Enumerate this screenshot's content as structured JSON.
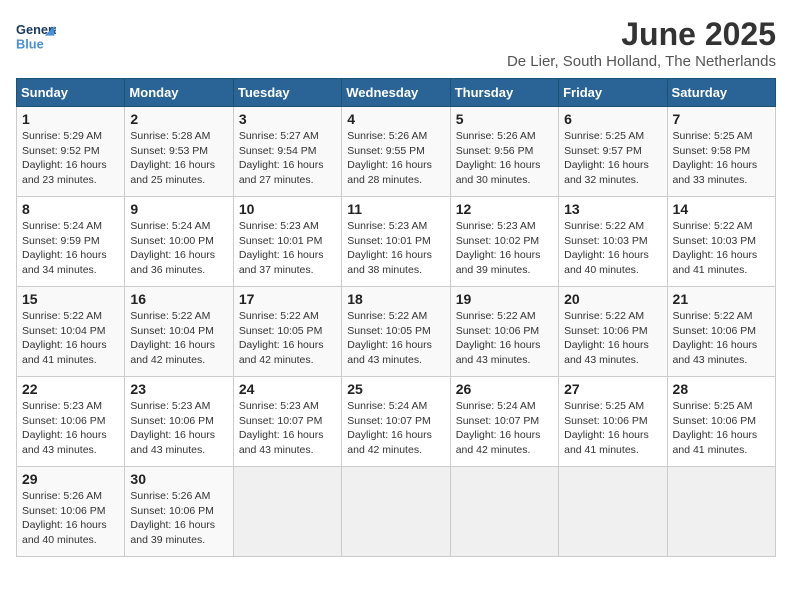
{
  "header": {
    "logo_line1": "General",
    "logo_line2": "Blue",
    "title": "June 2025",
    "subtitle": "De Lier, South Holland, The Netherlands"
  },
  "weekdays": [
    "Sunday",
    "Monday",
    "Tuesday",
    "Wednesday",
    "Thursday",
    "Friday",
    "Saturday"
  ],
  "weeks": [
    [
      {
        "day": 1,
        "sunrise": "5:29 AM",
        "sunset": "9:52 PM",
        "daylight": "16 hours and 23 minutes."
      },
      {
        "day": 2,
        "sunrise": "5:28 AM",
        "sunset": "9:53 PM",
        "daylight": "16 hours and 25 minutes."
      },
      {
        "day": 3,
        "sunrise": "5:27 AM",
        "sunset": "9:54 PM",
        "daylight": "16 hours and 27 minutes."
      },
      {
        "day": 4,
        "sunrise": "5:26 AM",
        "sunset": "9:55 PM",
        "daylight": "16 hours and 28 minutes."
      },
      {
        "day": 5,
        "sunrise": "5:26 AM",
        "sunset": "9:56 PM",
        "daylight": "16 hours and 30 minutes."
      },
      {
        "day": 6,
        "sunrise": "5:25 AM",
        "sunset": "9:57 PM",
        "daylight": "16 hours and 32 minutes."
      },
      {
        "day": 7,
        "sunrise": "5:25 AM",
        "sunset": "9:58 PM",
        "daylight": "16 hours and 33 minutes."
      }
    ],
    [
      {
        "day": 8,
        "sunrise": "5:24 AM",
        "sunset": "9:59 PM",
        "daylight": "16 hours and 34 minutes."
      },
      {
        "day": 9,
        "sunrise": "5:24 AM",
        "sunset": "10:00 PM",
        "daylight": "16 hours and 36 minutes."
      },
      {
        "day": 10,
        "sunrise": "5:23 AM",
        "sunset": "10:01 PM",
        "daylight": "16 hours and 37 minutes."
      },
      {
        "day": 11,
        "sunrise": "5:23 AM",
        "sunset": "10:01 PM",
        "daylight": "16 hours and 38 minutes."
      },
      {
        "day": 12,
        "sunrise": "5:23 AM",
        "sunset": "10:02 PM",
        "daylight": "16 hours and 39 minutes."
      },
      {
        "day": 13,
        "sunrise": "5:22 AM",
        "sunset": "10:03 PM",
        "daylight": "16 hours and 40 minutes."
      },
      {
        "day": 14,
        "sunrise": "5:22 AM",
        "sunset": "10:03 PM",
        "daylight": "16 hours and 41 minutes."
      }
    ],
    [
      {
        "day": 15,
        "sunrise": "5:22 AM",
        "sunset": "10:04 PM",
        "daylight": "16 hours and 41 minutes."
      },
      {
        "day": 16,
        "sunrise": "5:22 AM",
        "sunset": "10:04 PM",
        "daylight": "16 hours and 42 minutes."
      },
      {
        "day": 17,
        "sunrise": "5:22 AM",
        "sunset": "10:05 PM",
        "daylight": "16 hours and 42 minutes."
      },
      {
        "day": 18,
        "sunrise": "5:22 AM",
        "sunset": "10:05 PM",
        "daylight": "16 hours and 43 minutes."
      },
      {
        "day": 19,
        "sunrise": "5:22 AM",
        "sunset": "10:06 PM",
        "daylight": "16 hours and 43 minutes."
      },
      {
        "day": 20,
        "sunrise": "5:22 AM",
        "sunset": "10:06 PM",
        "daylight": "16 hours and 43 minutes."
      },
      {
        "day": 21,
        "sunrise": "5:22 AM",
        "sunset": "10:06 PM",
        "daylight": "16 hours and 43 minutes."
      }
    ],
    [
      {
        "day": 22,
        "sunrise": "5:23 AM",
        "sunset": "10:06 PM",
        "daylight": "16 hours and 43 minutes."
      },
      {
        "day": 23,
        "sunrise": "5:23 AM",
        "sunset": "10:06 PM",
        "daylight": "16 hours and 43 minutes."
      },
      {
        "day": 24,
        "sunrise": "5:23 AM",
        "sunset": "10:07 PM",
        "daylight": "16 hours and 43 minutes."
      },
      {
        "day": 25,
        "sunrise": "5:24 AM",
        "sunset": "10:07 PM",
        "daylight": "16 hours and 42 minutes."
      },
      {
        "day": 26,
        "sunrise": "5:24 AM",
        "sunset": "10:07 PM",
        "daylight": "16 hours and 42 minutes."
      },
      {
        "day": 27,
        "sunrise": "5:25 AM",
        "sunset": "10:06 PM",
        "daylight": "16 hours and 41 minutes."
      },
      {
        "day": 28,
        "sunrise": "5:25 AM",
        "sunset": "10:06 PM",
        "daylight": "16 hours and 41 minutes."
      }
    ],
    [
      {
        "day": 29,
        "sunrise": "5:26 AM",
        "sunset": "10:06 PM",
        "daylight": "16 hours and 40 minutes."
      },
      {
        "day": 30,
        "sunrise": "5:26 AM",
        "sunset": "10:06 PM",
        "daylight": "16 hours and 39 minutes."
      },
      null,
      null,
      null,
      null,
      null
    ]
  ],
  "labels": {
    "sunrise": "Sunrise:",
    "sunset": "Sunset:",
    "daylight": "Daylight:"
  }
}
